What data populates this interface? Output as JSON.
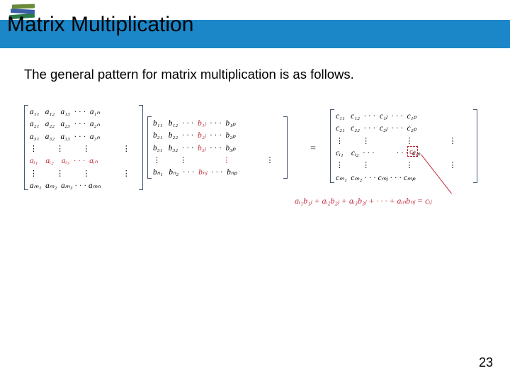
{
  "header": {
    "title": "Matrix Multiplication",
    "icon": "stacked-books-icon"
  },
  "body": {
    "intro": "The general pattern for matrix multiplication is as follows."
  },
  "figure": {
    "matrixA": {
      "rows": [
        [
          "a₁₁",
          "a₁₂",
          "a₁₃",
          "· · ·",
          "a₁ₙ"
        ],
        [
          "a₂₁",
          "a₂₂",
          "a₂₃",
          "· · ·",
          "a₂ₙ"
        ],
        [
          "a₃₁",
          "a₃₂",
          "a₃₃",
          "· · ·",
          "a₃ₙ"
        ],
        [
          "⋮",
          "⋮",
          "⋮",
          "",
          "⋮"
        ],
        [
          "aᵢ₁",
          "aᵢ₂",
          "aᵢ₃",
          "· · ·",
          "aᵢₙ"
        ],
        [
          "⋮",
          "⋮",
          "⋮",
          "",
          "⋮"
        ],
        [
          "aₘ₁",
          "aₘ₂",
          "aₘ₃",
          "· · ·",
          "aₘₙ"
        ]
      ],
      "highlight_row_index": 4
    },
    "matrixB": {
      "rows": [
        [
          "b₁₁",
          "b₁₂",
          "· · ·",
          "b₁ⱼ",
          "· · ·",
          "b₁ₚ"
        ],
        [
          "b₂₁",
          "b₂₂",
          "· · ·",
          "b₂ⱼ",
          "· · ·",
          "b₂ₚ"
        ],
        [
          "b₃₁",
          "b₃₂",
          "· · ·",
          "b₃ⱼ",
          "· · ·",
          "b₃ₚ"
        ],
        [
          "⋮",
          "⋮",
          "",
          "⋮",
          "",
          "⋮"
        ],
        [
          "bₙ₁",
          "bₙ₂",
          "· · ·",
          "bₙⱼ",
          "· · ·",
          "bₙₚ"
        ]
      ],
      "highlight_col_index": 3
    },
    "equals": "=",
    "matrixC": {
      "rows": [
        [
          "c₁₁",
          "c₁₂",
          "· · ·",
          "c₁ⱼ",
          "· · ·",
          "c₁ₚ"
        ],
        [
          "c₂₁",
          "c₂₂",
          "· · ·",
          "c₂ⱼ",
          "· · ·",
          "c₂ₚ"
        ],
        [
          "⋮",
          "⋮",
          "",
          "⋮",
          "",
          "⋮"
        ],
        [
          "cᵢ₁",
          "cᵢ₂",
          "· · ·",
          "cᵢⱼ",
          "· · ·",
          "cᵢₚ"
        ],
        [
          "⋮",
          "⋮",
          "",
          "⋮",
          "",
          "⋮"
        ],
        [
          "cₘ₁",
          "cₘ₂",
          "· · ·",
          "cₘⱼ",
          "· · ·",
          "cₘₚ"
        ]
      ],
      "highlight_cell": "cᵢⱼ"
    },
    "formula": "aᵢ₁b₁ⱼ + aᵢ₂b₂ⱼ + aᵢ₃b₃ⱼ + · · · + aᵢₙbₙⱼ = cᵢⱼ"
  },
  "footer": {
    "page_number": "23"
  }
}
